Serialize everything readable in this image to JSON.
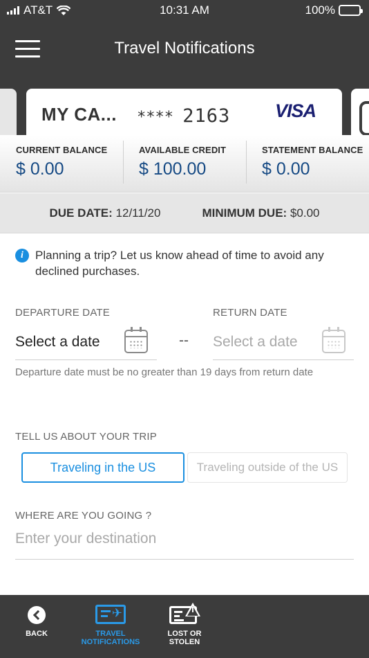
{
  "status_bar": {
    "carrier": "AT&T",
    "time": "10:31 AM",
    "battery": "100%"
  },
  "header": {
    "title": "Travel Notifications",
    "menu_icon": "hamburger-menu-icon"
  },
  "card": {
    "name": "MY CA...",
    "number_mask": "****",
    "last4": "2163",
    "network": "VISA"
  },
  "balances": [
    {
      "label": "CURRENT BALANCE",
      "value": "$ 0.00"
    },
    {
      "label": "AVAILABLE CREDIT",
      "value": "$ 100.00"
    },
    {
      "label": "STATEMENT BALANCE",
      "value": "$ 0.00"
    }
  ],
  "due": {
    "date_label": "DUE DATE:",
    "date_value": "12/11/20",
    "min_label": "MINIMUM DUE:",
    "min_value": "$0.00"
  },
  "info": {
    "icon": "info-icon",
    "text": "Planning a trip? Let us know ahead of time to avoid any declined purchases."
  },
  "departure": {
    "label": "DEPARTURE DATE",
    "value": "Select a date",
    "icon": "calendar-icon"
  },
  "separator": "--",
  "return": {
    "label": "RETURN DATE",
    "placeholder": "Select a date",
    "icon": "calendar-icon"
  },
  "hint": "Departure date must be no greater than 19 days from return date",
  "trip": {
    "label": "TELL US ABOUT YOUR TRIP",
    "options": [
      "Traveling in the US",
      "Traveling outside of the US"
    ],
    "selected": "Traveling in the US"
  },
  "destination": {
    "label": "WHERE ARE YOU GOING ?",
    "placeholder": "Enter your destination"
  },
  "tabs": {
    "back": "BACK",
    "travel_line1": "TRAVEL",
    "travel_line2": "NOTIFICATIONS",
    "lost_line1": "LOST OR",
    "lost_line2": "STOLEN"
  },
  "colors": {
    "header_bg": "#3c3c3c",
    "accent_blue": "#1a8fe0",
    "balance_blue": "#164a84",
    "visa_blue": "#1a1f71"
  }
}
